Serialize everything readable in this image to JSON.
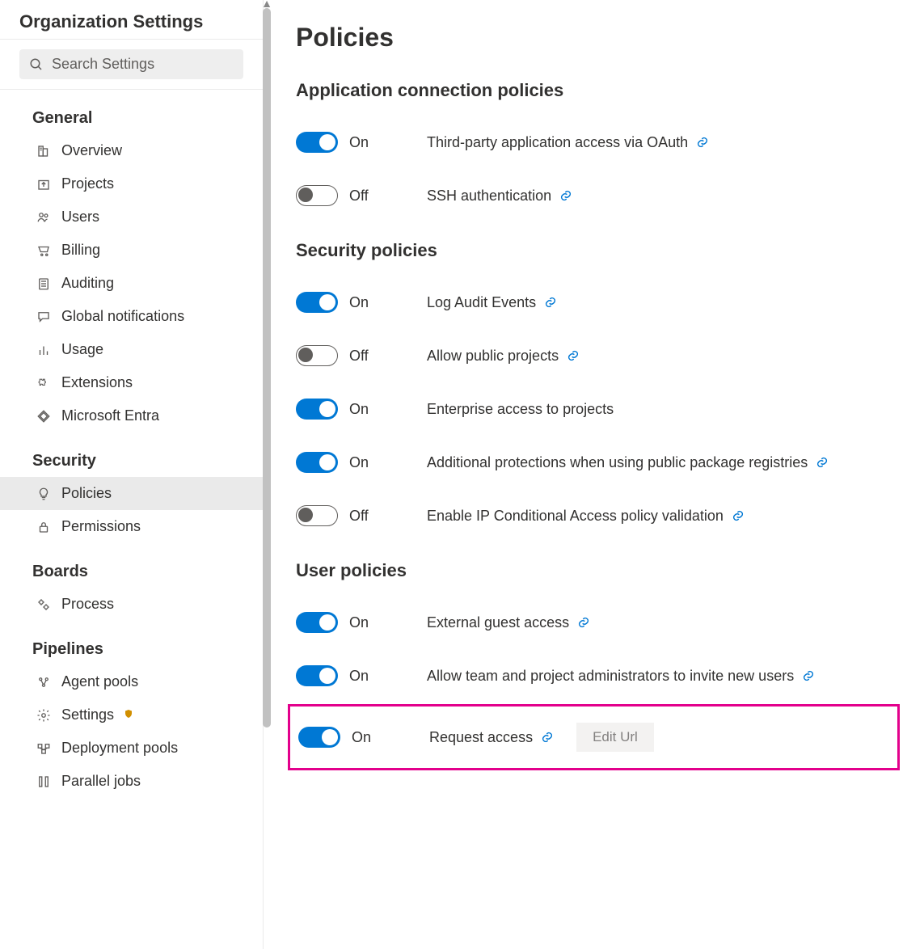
{
  "sidebar": {
    "title": "Organization Settings",
    "search_placeholder": "Search Settings",
    "sections": [
      {
        "header": "General",
        "items": [
          {
            "icon": "building",
            "label": "Overview"
          },
          {
            "icon": "upload-box",
            "label": "Projects"
          },
          {
            "icon": "users",
            "label": "Users"
          },
          {
            "icon": "cart",
            "label": "Billing"
          },
          {
            "icon": "list",
            "label": "Auditing"
          },
          {
            "icon": "chat",
            "label": "Global notifications"
          },
          {
            "icon": "bar-chart",
            "label": "Usage"
          },
          {
            "icon": "puzzle",
            "label": "Extensions"
          },
          {
            "icon": "diamond",
            "label": "Microsoft Entra"
          }
        ]
      },
      {
        "header": "Security",
        "items": [
          {
            "icon": "bulb",
            "label": "Policies",
            "active": true
          },
          {
            "icon": "lock",
            "label": "Permissions"
          }
        ]
      },
      {
        "header": "Boards",
        "items": [
          {
            "icon": "gears",
            "label": "Process"
          }
        ]
      },
      {
        "header": "Pipelines",
        "items": [
          {
            "icon": "pool",
            "label": "Agent pools"
          },
          {
            "icon": "gear",
            "label": "Settings",
            "shield": true
          },
          {
            "icon": "deploy",
            "label": "Deployment pools"
          },
          {
            "icon": "parallel",
            "label": "Parallel jobs"
          }
        ]
      }
    ]
  },
  "page_title": "Policies",
  "policy_sections": [
    {
      "title": "Application connection policies",
      "rows": [
        {
          "on": true,
          "state_label": "On",
          "desc": "Third-party application access via OAuth",
          "link": true
        },
        {
          "on": false,
          "state_label": "Off",
          "desc": "SSH authentication",
          "link": true
        }
      ]
    },
    {
      "title": "Security policies",
      "rows": [
        {
          "on": true,
          "state_label": "On",
          "desc": "Log Audit Events",
          "link": true
        },
        {
          "on": false,
          "state_label": "Off",
          "desc": "Allow public projects",
          "link": true
        },
        {
          "on": true,
          "state_label": "On",
          "desc": "Enterprise access to projects",
          "link": false
        },
        {
          "on": true,
          "state_label": "On",
          "desc": "Additional protections when using public package registries",
          "link": true
        },
        {
          "on": false,
          "state_label": "Off",
          "desc": "Enable IP Conditional Access policy validation",
          "link": true
        }
      ]
    },
    {
      "title": "User policies",
      "rows": [
        {
          "on": true,
          "state_label": "On",
          "desc": "External guest access",
          "link": true
        },
        {
          "on": true,
          "state_label": "On",
          "desc": "Allow team and project administrators to invite new users",
          "link": true
        },
        {
          "on": true,
          "state_label": "On",
          "desc": "Request access",
          "link": true,
          "edit_button": "Edit Url",
          "highlight": true
        }
      ]
    }
  ]
}
